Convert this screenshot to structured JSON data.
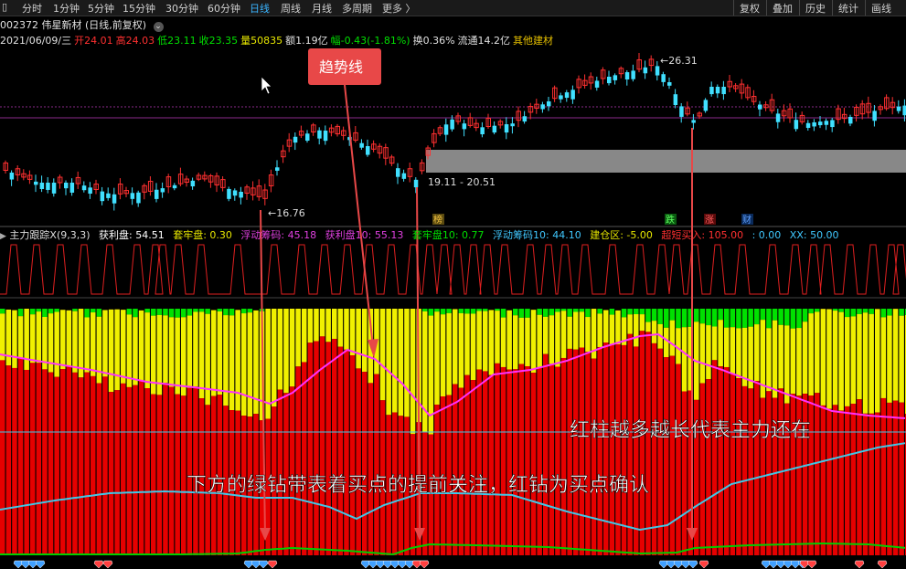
{
  "toolbar": {
    "items": [
      "分时",
      "1分钟",
      "5分钟",
      "15分钟",
      "30分钟",
      "60分钟",
      "日线",
      "周线",
      "月线",
      "多周期",
      "更多 〉"
    ],
    "active_index": 6,
    "right_items": [
      "复权",
      "叠加",
      "历史",
      "统计",
      "画线"
    ]
  },
  "stock": {
    "code_name": "002372 伟星新材 (日线,前复权)",
    "date": "2021/06/09/三",
    "open_label": "开",
    "open": "24.01",
    "high_label": "高",
    "high": "24.03",
    "low_label": "低",
    "low": "23.11",
    "close_label": "收",
    "close": "23.35",
    "volume": "量50835",
    "amount": "额1.19亿",
    "change": "幅-0.43(-1.81%)",
    "turnover": "换0.36%",
    "float_cap": "流通14.2亿",
    "concept": "其他建材"
  },
  "price_annotations": {
    "high_marker": "26.31",
    "low_marker": "16.76",
    "range_label": "19.11 - 20.51"
  },
  "event_tags": [
    "榜",
    "跌",
    "涨",
    "财"
  ],
  "indicator": {
    "name": "主力跟踪X(9,3,3)",
    "fields": [
      {
        "label": "获利盘: 54.51",
        "color": "#ffffff"
      },
      {
        "label": "套牢盘: 0.30",
        "color": "#e6e600"
      },
      {
        "label": "浮动筹码: 45.18",
        "color": "#e040e0"
      },
      {
        "label": "获利盘10: 55.13",
        "color": "#e040e0"
      },
      {
        "label": "套牢盘10: 0.77",
        "color": "#00e000"
      },
      {
        "label": "浮动筹码10: 44.10",
        "color": "#40c8ff"
      },
      {
        "label": "建仓区: -5.00",
        "color": "#e6e600"
      },
      {
        "label": "超短买入: 105.00",
        "color": "#ff3030"
      },
      {
        "label": ": 0.00",
        "color": "#40c8ff"
      },
      {
        "label": "XX: 50.00",
        "color": "#40c8ff"
      }
    ]
  },
  "annotations": {
    "trend_label": "趋势线",
    "text1": "红柱越多越长代表主力还在",
    "text2": "下方的绿钻带表着买点的提前关注，红钻为买点确认"
  },
  "colors": {
    "up": "#ff3030",
    "down": "#40e0ff",
    "bar_red": "#e60000",
    "bar_yellow": "#f0f000",
    "bar_green": "#00e000",
    "magenta": "#ff30ff",
    "cyan": "#40c8e8",
    "callout_bg": "#e84848"
  }
}
